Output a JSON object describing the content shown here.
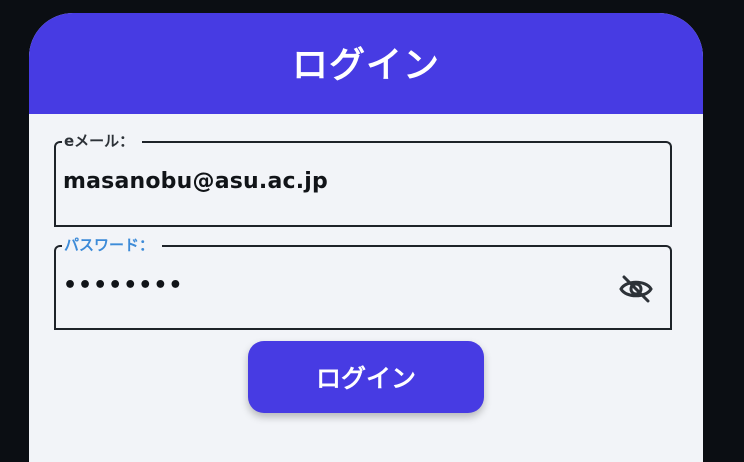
{
  "header": {
    "title": "ログイン"
  },
  "form": {
    "email": {
      "label": "eメール：",
      "value": "masanobu@asu.ac.jp"
    },
    "password": {
      "label": "パスワード：",
      "value": "••••••••",
      "visibility_icon": "eye-off-icon"
    },
    "submit_label": "ログイン"
  },
  "colors": {
    "accent": "#473be3",
    "background": "#0b0e13",
    "card": "#f2f4f8",
    "password_label": "#3d8bd8"
  }
}
